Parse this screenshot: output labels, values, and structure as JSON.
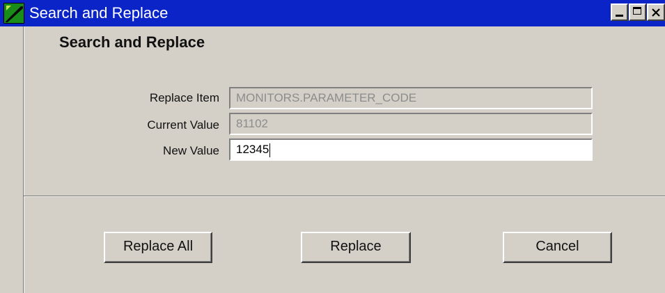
{
  "window": {
    "title": "Search and Replace",
    "app_icon": "app-logo-icon",
    "controls": {
      "minimize_icon": "minimize-icon",
      "maximize_icon": "maximize-icon",
      "close_icon": "close-icon"
    },
    "colors": {
      "titlebar": "#0a24c8",
      "face": "#d4d0c8"
    }
  },
  "dialog": {
    "heading": "Search and Replace",
    "fields": [
      {
        "label": "Replace Item",
        "value": "MONITORS.PARAMETER_CODE",
        "readonly": true
      },
      {
        "label": "Current Value",
        "value": "81102",
        "readonly": true
      },
      {
        "label": "New Value",
        "value": "12345",
        "readonly": false
      }
    ],
    "buttons": {
      "replace_all": "Replace All",
      "replace": "Replace",
      "cancel": "Cancel"
    }
  }
}
